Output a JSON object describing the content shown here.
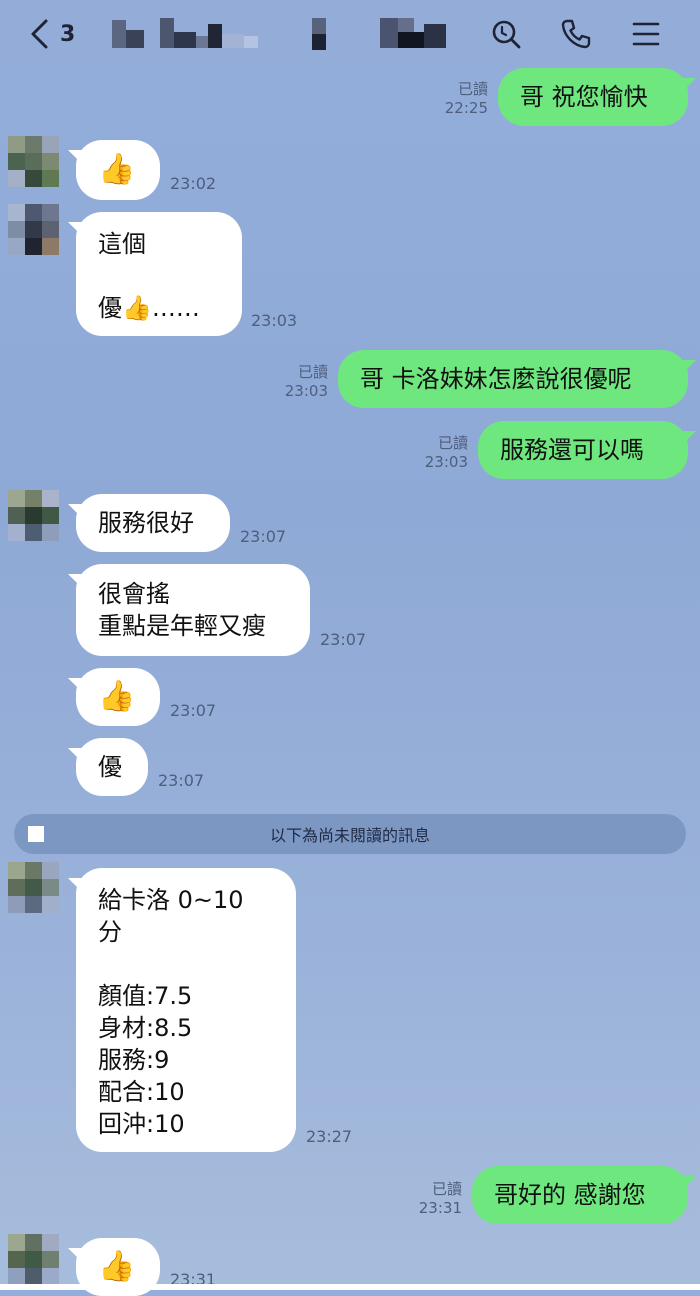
{
  "header": {
    "back_icon": "chevron-left-icon",
    "unread_count": "3",
    "search_icon": "search-icon",
    "call_icon": "phone-icon",
    "menu_icon": "menu-icon"
  },
  "messages": [
    {
      "id": "m1",
      "dir": "out",
      "text": "哥 祝您愉快",
      "read": "已讀",
      "time": "22:25"
    },
    {
      "id": "m2",
      "dir": "in",
      "text": "👍",
      "time": "23:02"
    },
    {
      "id": "m3",
      "dir": "in",
      "text": "這個\n\n優👍……",
      "time": "23:03"
    },
    {
      "id": "m4",
      "dir": "out",
      "text": "哥 卡洛妹妹怎麼說很優呢",
      "read": "已讀",
      "time": "23:03"
    },
    {
      "id": "m5",
      "dir": "out",
      "text": "服務還可以嗎",
      "read": "已讀",
      "time": "23:03"
    },
    {
      "id": "m6",
      "dir": "in",
      "text": "服務很好",
      "time": "23:07"
    },
    {
      "id": "m7",
      "dir": "in",
      "text": "很會搖\n重點是年輕又瘦",
      "time": "23:07"
    },
    {
      "id": "m8",
      "dir": "in",
      "text": "👍",
      "time": "23:07"
    },
    {
      "id": "m9",
      "dir": "in",
      "text": "優",
      "time": "23:07"
    },
    {
      "id": "m10",
      "dir": "in",
      "text": "給卡洛 0~10 分\n\n顏值:7.5\n身材:8.5\n服務:9\n配合:10\n回沖:10",
      "time": "23:27"
    },
    {
      "id": "m11",
      "dir": "out",
      "text": "哥好的 感謝您",
      "read": "已讀",
      "time": "23:31"
    },
    {
      "id": "m12",
      "dir": "in",
      "text": "👍",
      "time": "23:31"
    }
  ],
  "unread_divider": "以下為尚未閱讀的訊息",
  "colors": {
    "background": "#93aedb",
    "outgoing_bubble": "#6fe77f",
    "incoming_bubble": "#ffffff"
  }
}
